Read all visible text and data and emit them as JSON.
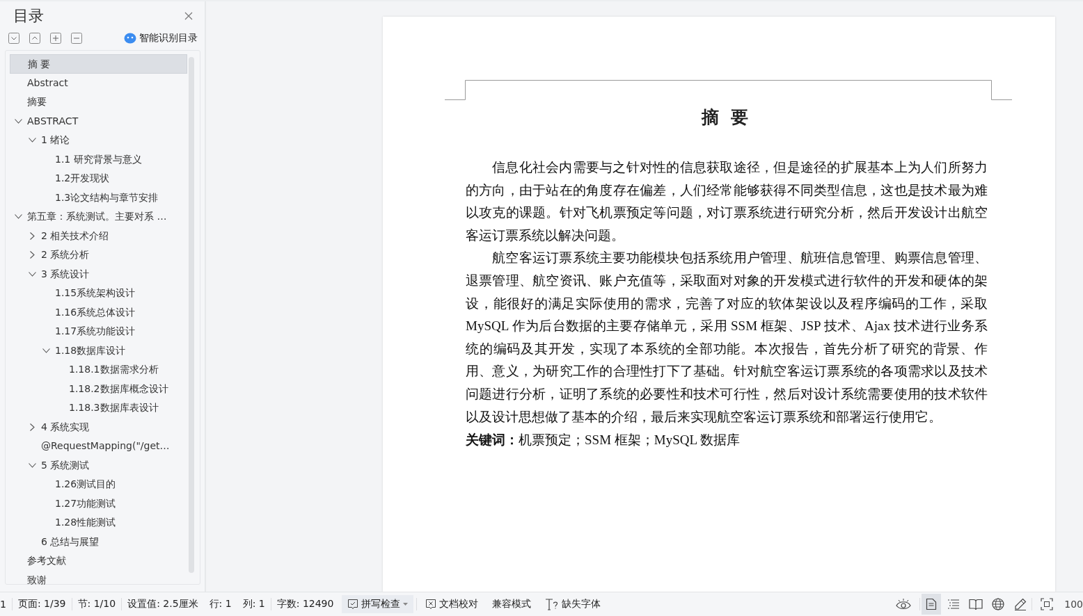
{
  "sidebar": {
    "title": "目录",
    "smart_button": "智能识别目录",
    "toc": [
      {
        "label": "摘 要",
        "selected": true
      },
      {
        "label": "Abstract",
        "selected": false
      },
      {
        "label": "摘要",
        "selected": false
      },
      {
        "label": "ABSTRACT",
        "selected": false,
        "expanded": true,
        "children": [
          {
            "label": "1 绪论",
            "selected": false,
            "expanded": true,
            "children": [
              {
                "label": "1.1  研究背景与意义",
                "selected": false
              },
              {
                "label": "1.2开发现状",
                "selected": false
              },
              {
                "label": "1.3论文结构与章节安排",
                "selected": false
              }
            ]
          }
        ]
      },
      {
        "label": "第五章：系统测试。主要对系 …",
        "selected": false,
        "expanded": true,
        "children": [
          {
            "label": "2  相关技术介绍",
            "selected": false,
            "expanded": false
          },
          {
            "label": "2  系统分析",
            "selected": false,
            "expanded": false
          },
          {
            "label": "3  系统设计",
            "selected": false,
            "expanded": true,
            "children": [
              {
                "label": "1.15系统架构设计",
                "selected": false
              },
              {
                "label": "1.16系统总体设计",
                "selected": false
              },
              {
                "label": "1.17系统功能设计",
                "selected": false
              },
              {
                "label": "1.18数据库设计",
                "selected": false,
                "expanded": true,
                "children": [
                  {
                    "label": "1.18.1数据需求分析",
                    "selected": false
                  },
                  {
                    "label": "1.18.2数据库概念设计",
                    "selected": false
                  },
                  {
                    "label": "1.18.3数据库表设计",
                    "selected": false
                  }
                ]
              }
            ]
          },
          {
            "label": "4 系统实现",
            "selected": false,
            "expanded": false
          },
          {
            "label": "@RequestMapping(\"/get…",
            "selected": false
          },
          {
            "label": "5  系统测试",
            "selected": false,
            "expanded": true,
            "children": [
              {
                "label": "1.26测试目的",
                "selected": false
              },
              {
                "label": "1.27功能测试",
                "selected": false
              },
              {
                "label": "1.28性能测试",
                "selected": false
              }
            ]
          },
          {
            "label": "6  总结与展望",
            "selected": false
          }
        ]
      },
      {
        "label": "参考文献",
        "selected": false
      },
      {
        "label": "致谢",
        "selected": false
      }
    ]
  },
  "document": {
    "heading": "摘  要",
    "paragraphs": [
      "信息化社会内需要与之针对性的信息获取途径，但是途径的扩展基本上为人们所努力的方向，由于站在的角度存在偏差，人们经常能够获得不同类型信息，这也是技术最为难以攻克的课题。针对飞机票预定等问题，对订票系统进行研究分析，然后开发设计出航空客运订票系统以解决问题。",
      "航空客运订票系统主要功能模块包括系统用户管理、航班信息管理、购票信息管理、退票管理、航空资讯、账户充值等，采取面对对象的开发模式进行软件的开发和硬体的架设，能很好的满足实际使用的需求，完善了对应的软体架设以及程序编码的工作，采取 MySQL 作为后台数据的主要存储单元，采用 SSM 框架、JSP 技术、Ajax 技术进行业务系统的编码及其开发，实现了本系统的全部功能。本次报告，首先分析了研究的背景、作用、意义，为研究工作的合理性打下了基础。针对航空客运订票系统的各项需求以及技术问题进行分析，证明了系统的必要性和技术可行性，然后对设计系统需要使用的技术软件以及设计思想做了基本的介绍，最后来实现航空客运订票系统和部署运行使用它。"
    ],
    "keywords": "**关键词：**机票预定；SSM 框架；MySQL 数据库"
  },
  "status_bar": {
    "items": [
      "1",
      "页面: 1/39",
      "节: 1/10",
      "设置值: 2.5厘米",
      "行: 1",
      "列: 1",
      "字数: 12490"
    ],
    "spell_check": "拼写检查",
    "proofread": "文档校对",
    "compat_mode": "兼容模式",
    "missing_fonts": "缺失字体",
    "view_modes": [
      {
        "kind": "page",
        "selected": true
      },
      {
        "kind": "outline",
        "selected": false
      },
      {
        "kind": "read",
        "selected": false
      },
      {
        "kind": "web",
        "selected": false
      },
      {
        "kind": "write",
        "selected": false
      }
    ],
    "zoom": "100"
  }
}
